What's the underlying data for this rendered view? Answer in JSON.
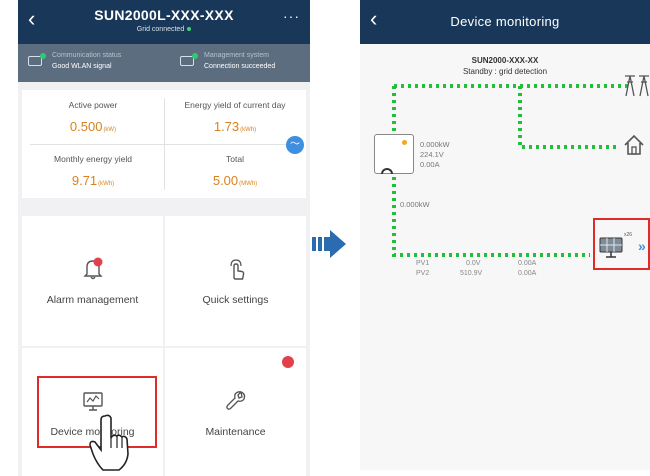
{
  "left": {
    "header": {
      "title": "SUN2000L-XXX-XXX",
      "subtitle": "Grid connected"
    },
    "status": {
      "comm_label": "Communication status",
      "comm_value": "Good WLAN signal",
      "mgmt_label": "Management system",
      "mgmt_value": "Connection succeeded"
    },
    "stats": [
      {
        "label": "Active power",
        "value": "0.500",
        "unit": "(kW)"
      },
      {
        "label": "Energy yield of current day",
        "value": "1.73",
        "unit": "(kWh)"
      },
      {
        "label": "Monthly energy yield",
        "value": "9.71",
        "unit": "(kWh)"
      },
      {
        "label": "Total",
        "value": "5.00",
        "unit": "(MWh)"
      }
    ],
    "tiles": [
      "Alarm management",
      "Quick settings",
      "Device monitoring",
      "Maintenance"
    ]
  },
  "right": {
    "header": {
      "title": "Device monitoring"
    },
    "device_name": "SUN2000-XXX-XX",
    "device_state": "Standby : grid detection",
    "inverter": {
      "power": "0.000kW",
      "voltage": "224.1V",
      "current": "0.00A"
    },
    "battery_power": "0.000kW",
    "pv": [
      {
        "name": "PV1",
        "voltage": "0.0V",
        "current": "0.00A"
      },
      {
        "name": "PV2",
        "voltage": "510.9V",
        "current": "0.00A"
      }
    ],
    "pv_count": "x26"
  },
  "colors": {
    "header": "#183759",
    "accent": "#d9821e",
    "highlight": "#e02b2b",
    "flow": "#22c03a"
  }
}
